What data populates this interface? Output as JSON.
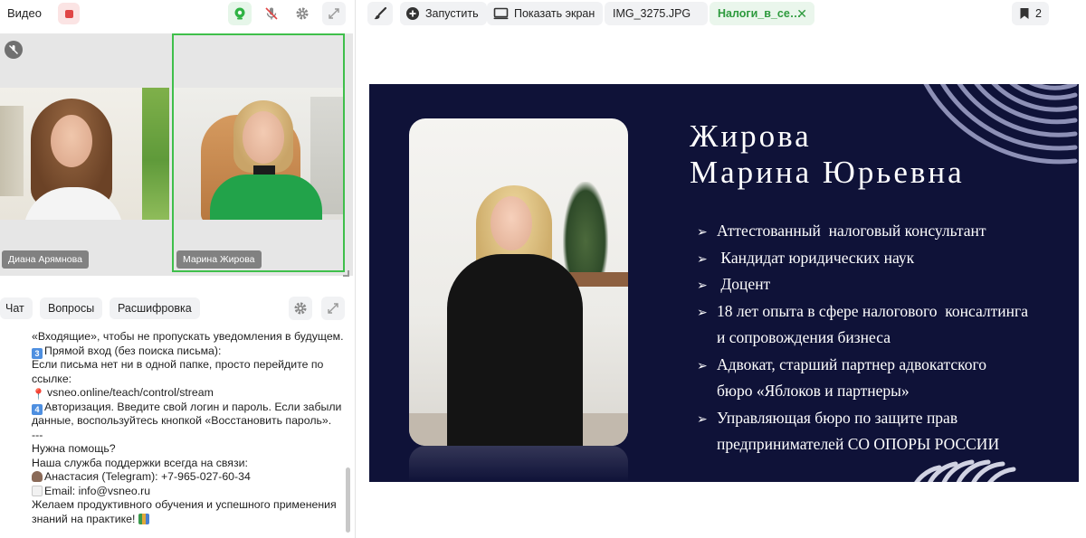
{
  "left_panel": {
    "video_label": "Видео",
    "participants": [
      {
        "name": "Диана Арямнова"
      },
      {
        "name": "Марина Жирова"
      }
    ]
  },
  "chat": {
    "tabs": [
      "Чат",
      "Вопросы",
      "Расшифровка"
    ],
    "lines": [
      {
        "icon": "",
        "text": "«Входящие», чтобы не пропускать уведомления в будущем."
      },
      {
        "icon": "keycap-3-icon",
        "text": "Прямой вход (без поиска письма):"
      },
      {
        "icon": "",
        "text": "Если письма нет ни в одной папке, просто перейдите по"
      },
      {
        "icon": "",
        "text": "ссылке:"
      },
      {
        "icon": "pin-icon",
        "text": "vsneo.online/teach/control/stream"
      },
      {
        "icon": "keycap-4-icon",
        "text": "Авторизация. Введите свой логин и пароль. Если забыли"
      },
      {
        "icon": "",
        "text": "данные, воспользуйтесь кнопкой «Восстановить пароль»."
      },
      {
        "icon": "",
        "text": "---"
      },
      {
        "icon": "",
        "text": "Нужна помощь?"
      },
      {
        "icon": "",
        "text": "Наша служба поддержки всегда на связи:"
      },
      {
        "icon": "person-icon",
        "text": "Анастасия (Telegram): +7-965-027-60-34"
      },
      {
        "icon": "mail-icon",
        "text": "Email: info@vsneo.ru"
      },
      {
        "icon": "",
        "text": "Желаем продуктивного обучения и успешного применения"
      },
      {
        "icon": "books-icon",
        "text": "знаний на практике!"
      }
    ]
  },
  "toolbar": {
    "launch_label": "Запустить",
    "share_screen_label": "Показать экран",
    "file_tabs": [
      {
        "label": "IMG_3275.JPG",
        "active": false
      },
      {
        "label": "Налоги_в_се…",
        "active": true
      }
    ],
    "bookmark_count": "2"
  },
  "slide": {
    "title_line1": "Жирова",
    "title_line2": "Марина Юрьевна",
    "bullets": [
      "Аттестованный  налоговый консультант",
      " Кандидат юридических наук",
      " Доцент",
      "18 лет опыта в сфере налогового  консалтинга",
      "и сопровождения бизнеса",
      "Адвокат, старший партнер адвокатского",
      "бюро «Яблоков и партнеры»",
      "Управляющая бюро по защите прав",
      "предпринимателей СО ОПОРЫ РОССИИ"
    ],
    "bullet_arrows": [
      true,
      true,
      true,
      true,
      false,
      true,
      false,
      true,
      false
    ],
    "background_color": "#0f1238",
    "text_color": "#ffffff"
  },
  "colors": {
    "accent_green": "#3fbf4b",
    "record_red": "#e04646",
    "active_tab_text": "#2d9a3d"
  }
}
